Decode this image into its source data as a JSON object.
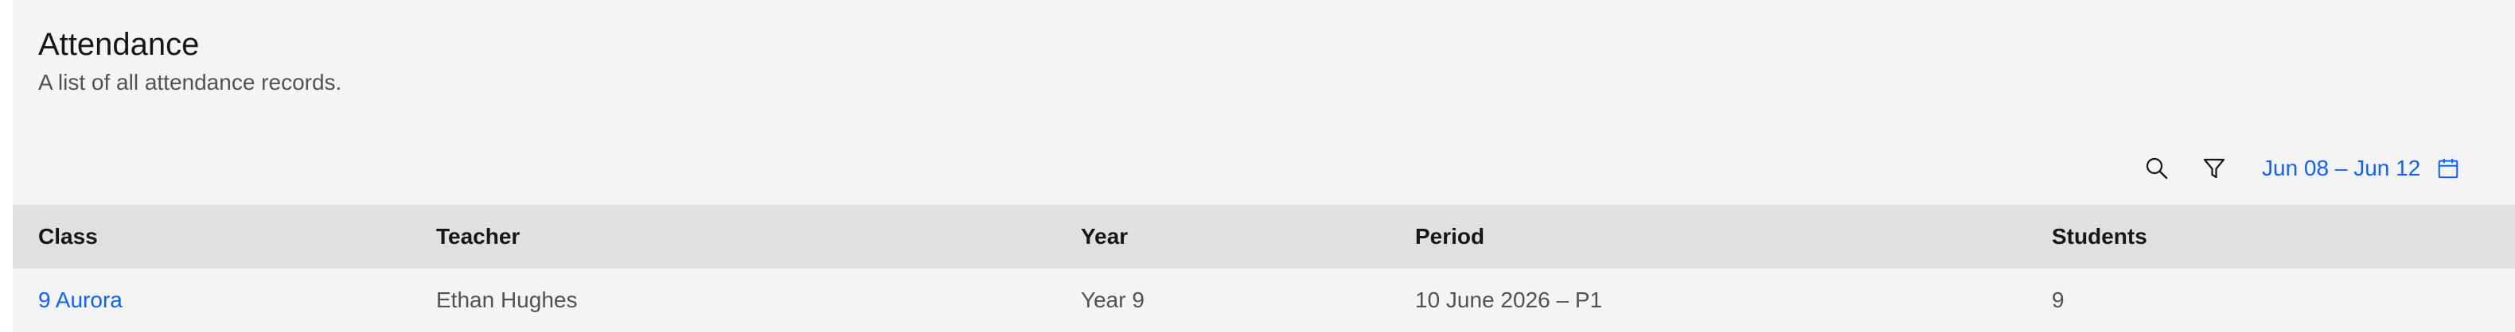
{
  "page": {
    "title": "Attendance",
    "subtitle": "A list of all attendance records."
  },
  "toolbar": {
    "search_icon": "search-icon",
    "filter_icon": "filter-icon",
    "date_range_label": "Jun 08 – Jun 12",
    "calendar_icon": "calendar-icon"
  },
  "table": {
    "headers": {
      "class": "Class",
      "teacher": "Teacher",
      "year": "Year",
      "period": "Period",
      "students": "Students"
    },
    "rows": [
      {
        "class": "9 Aurora",
        "teacher": "Ethan Hughes",
        "year": "Year 9",
        "period": "10 June 2026 – P1",
        "students": "9"
      }
    ]
  },
  "colors": {
    "accent": "#0f62fe",
    "background": "#f4f4f4",
    "header_bg": "#e0e0e0"
  }
}
